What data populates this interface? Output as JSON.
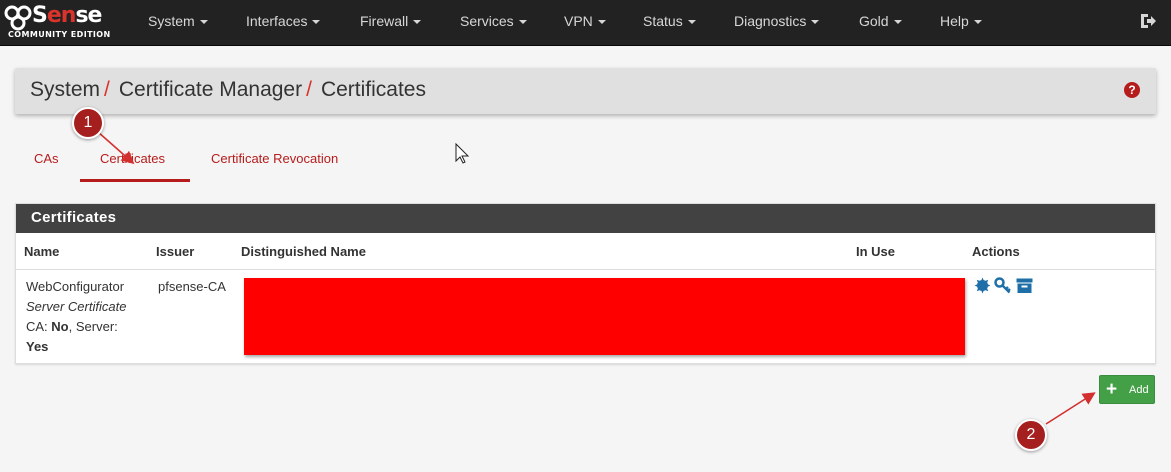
{
  "brand": {
    "name_pre": "S",
    "name_accent": "en",
    "name_post": "se",
    "subtitle": "COMMUNITY EDITION"
  },
  "nav": {
    "items": [
      {
        "label": "System"
      },
      {
        "label": "Interfaces"
      },
      {
        "label": "Firewall"
      },
      {
        "label": "Services"
      },
      {
        "label": "VPN"
      },
      {
        "label": "Status"
      },
      {
        "label": "Diagnostics"
      },
      {
        "label": "Gold"
      },
      {
        "label": "Help"
      }
    ],
    "logout_icon": "sign-out-icon"
  },
  "breadcrumb": {
    "items": [
      "System",
      "Certificate Manager",
      "Certificates"
    ],
    "separator": "/",
    "help_glyph": "?"
  },
  "tabs": [
    {
      "label": "CAs",
      "active": false
    },
    {
      "label": "Certificates",
      "active": true
    },
    {
      "label": "Certificate Revocation",
      "active": false
    }
  ],
  "panel": {
    "title": "Certificates",
    "columns": [
      "Name",
      "Issuer",
      "Distinguished Name",
      "In Use",
      "Actions"
    ],
    "rows": [
      {
        "name": "WebConfigurator",
        "type": "Server Certificate",
        "ca_label": "CA: ",
        "ca_value": "No",
        "server_label": ", Server:",
        "server_value": "Yes",
        "issuer": "pfsense-CA",
        "distinguished_name": "",
        "in_use": "",
        "actions": [
          "export-cert-icon",
          "export-key-icon",
          "archive-icon"
        ]
      }
    ]
  },
  "add_button": {
    "label": "Add",
    "icon": "plus-icon"
  },
  "annotations": [
    {
      "label": "1"
    },
    {
      "label": "2"
    }
  ],
  "colors": {
    "navbar": "#222222",
    "accent_red": "#b71c1c",
    "panel_heading": "#424242",
    "add_green": "#43a047",
    "redaction": "#ff0000"
  }
}
